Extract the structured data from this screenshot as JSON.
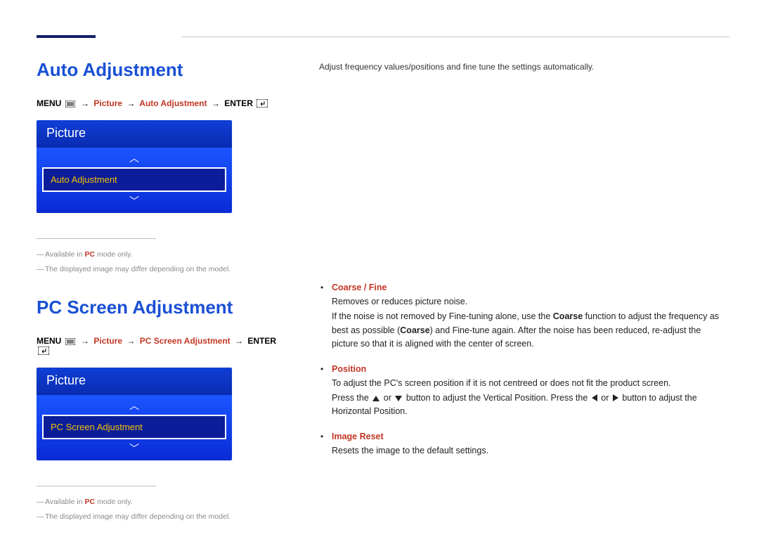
{
  "section1": {
    "title": "Auto Adjustment",
    "breadcrumb": {
      "menu": "MENU",
      "path1": "Picture",
      "path2": "Auto Adjustment",
      "enter": "ENTER",
      "arrow": "→"
    },
    "osd": {
      "title": "Picture",
      "selected": "Auto Adjustment"
    },
    "notes": {
      "n1_pre": "Available in ",
      "n1_pc": "PC",
      "n1_post": " mode only.",
      "n2": "The displayed image may differ depending on the model."
    }
  },
  "section2": {
    "title": "PC Screen Adjustment",
    "breadcrumb": {
      "menu": "MENU",
      "path1": "Picture",
      "path2": "PC Screen Adjustment",
      "enter": "ENTER",
      "arrow": "→"
    },
    "osd": {
      "title": "Picture",
      "selected": "PC Screen Adjustment"
    },
    "notes": {
      "n1_pre": "Available in ",
      "n1_pc": "PC",
      "n1_post": " mode only.",
      "n2": "The displayed image may differ depending on the model."
    }
  },
  "right": {
    "top_line": "Adjust frequency values/positions and fine tune the settings automatically.",
    "items": {
      "coarse_fine": {
        "term": "Coarse / Fine",
        "p1": "Removes or reduces picture noise.",
        "p2a": "If the noise is not removed by Fine-tuning alone, use the ",
        "p2b": "Coarse",
        "p2c": " function to adjust the frequency as best as possible (",
        "p2d": "Coarse",
        "p2e": ") and Fine-tune again. After the noise has been reduced, re-adjust the picture so that it is aligned with the center of screen."
      },
      "position": {
        "term": "Position",
        "p1": "To adjust the PC's screen position if it is not centreed or does not fit the product screen.",
        "p2a": "Press the ",
        "p2b": " or ",
        "p2c": " button to adjust the Vertical Position. Press the ",
        "p2d": " or ",
        "p2e": " button to adjust the Horizontal Position."
      },
      "image_reset": {
        "term": "Image Reset",
        "p1": "Resets the image to the default settings."
      }
    }
  }
}
